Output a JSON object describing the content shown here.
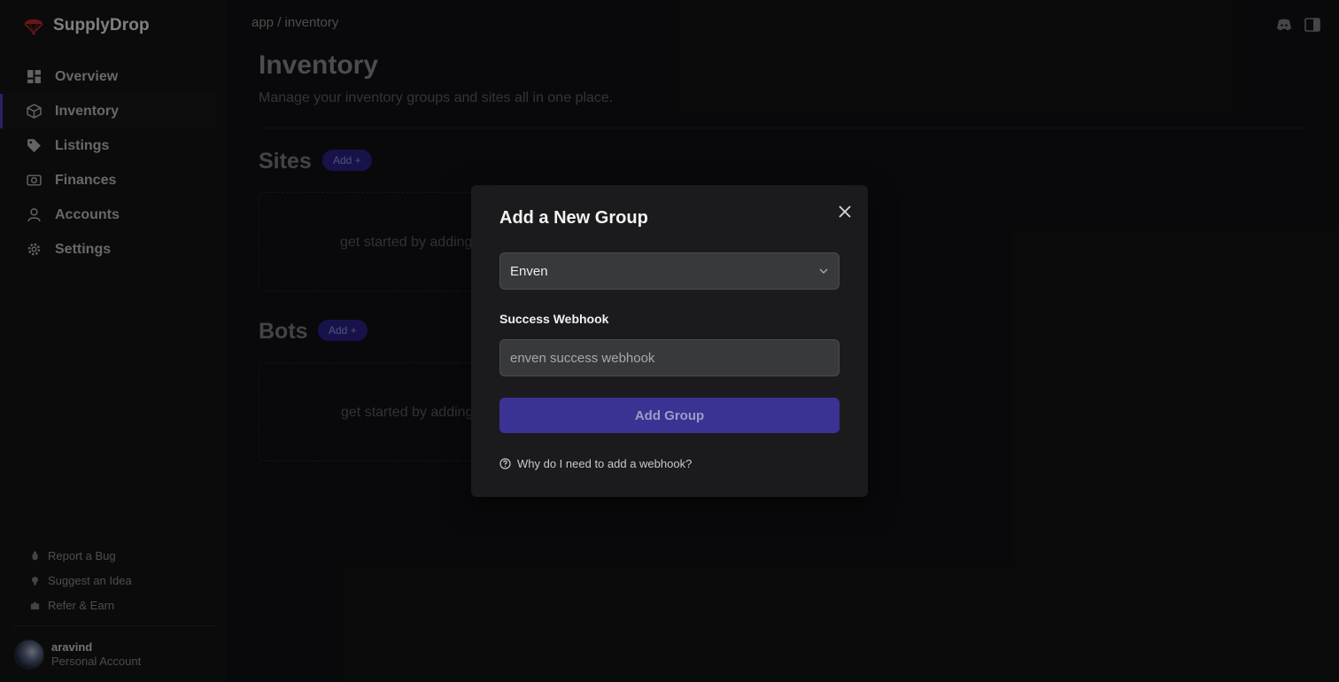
{
  "app": {
    "name": "SupplyDrop"
  },
  "breadcrumb": "app / inventory",
  "sidebar": {
    "items": [
      {
        "label": "Overview",
        "icon": "grid-icon"
      },
      {
        "label": "Inventory",
        "icon": "box-icon",
        "active": true
      },
      {
        "label": "Listings",
        "icon": "tag-icon"
      },
      {
        "label": "Finances",
        "icon": "camera-icon"
      },
      {
        "label": "Accounts",
        "icon": "user-icon"
      },
      {
        "label": "Settings",
        "icon": "gear-icon"
      }
    ],
    "footer_links": [
      {
        "label": "Report a Bug",
        "icon": "bug-icon"
      },
      {
        "label": "Suggest an Idea",
        "icon": "lightbulb-icon"
      },
      {
        "label": "Refer & Earn",
        "icon": "puzzle-icon"
      }
    ],
    "account": {
      "name": "aravind",
      "type": "Personal Account"
    }
  },
  "main": {
    "title": "Inventory",
    "subtitle": "Manage your inventory groups and sites all in one place.",
    "sites": {
      "title": "Sites",
      "add_label": "Add +",
      "empty_text": "get started by adding"
    },
    "bots": {
      "title": "Bots",
      "add_label": "Add +",
      "empty_text": "get started by adding"
    }
  },
  "modal": {
    "title": "Add a New Group",
    "select_value": "Enven",
    "field_label": "Success Webhook",
    "input_placeholder": "enven success webhook",
    "submit_label": "Add Group",
    "help_text": "Why do I need to add a webhook?"
  },
  "colors": {
    "accent": "#3a3394",
    "brand_red": "#c0282d"
  }
}
